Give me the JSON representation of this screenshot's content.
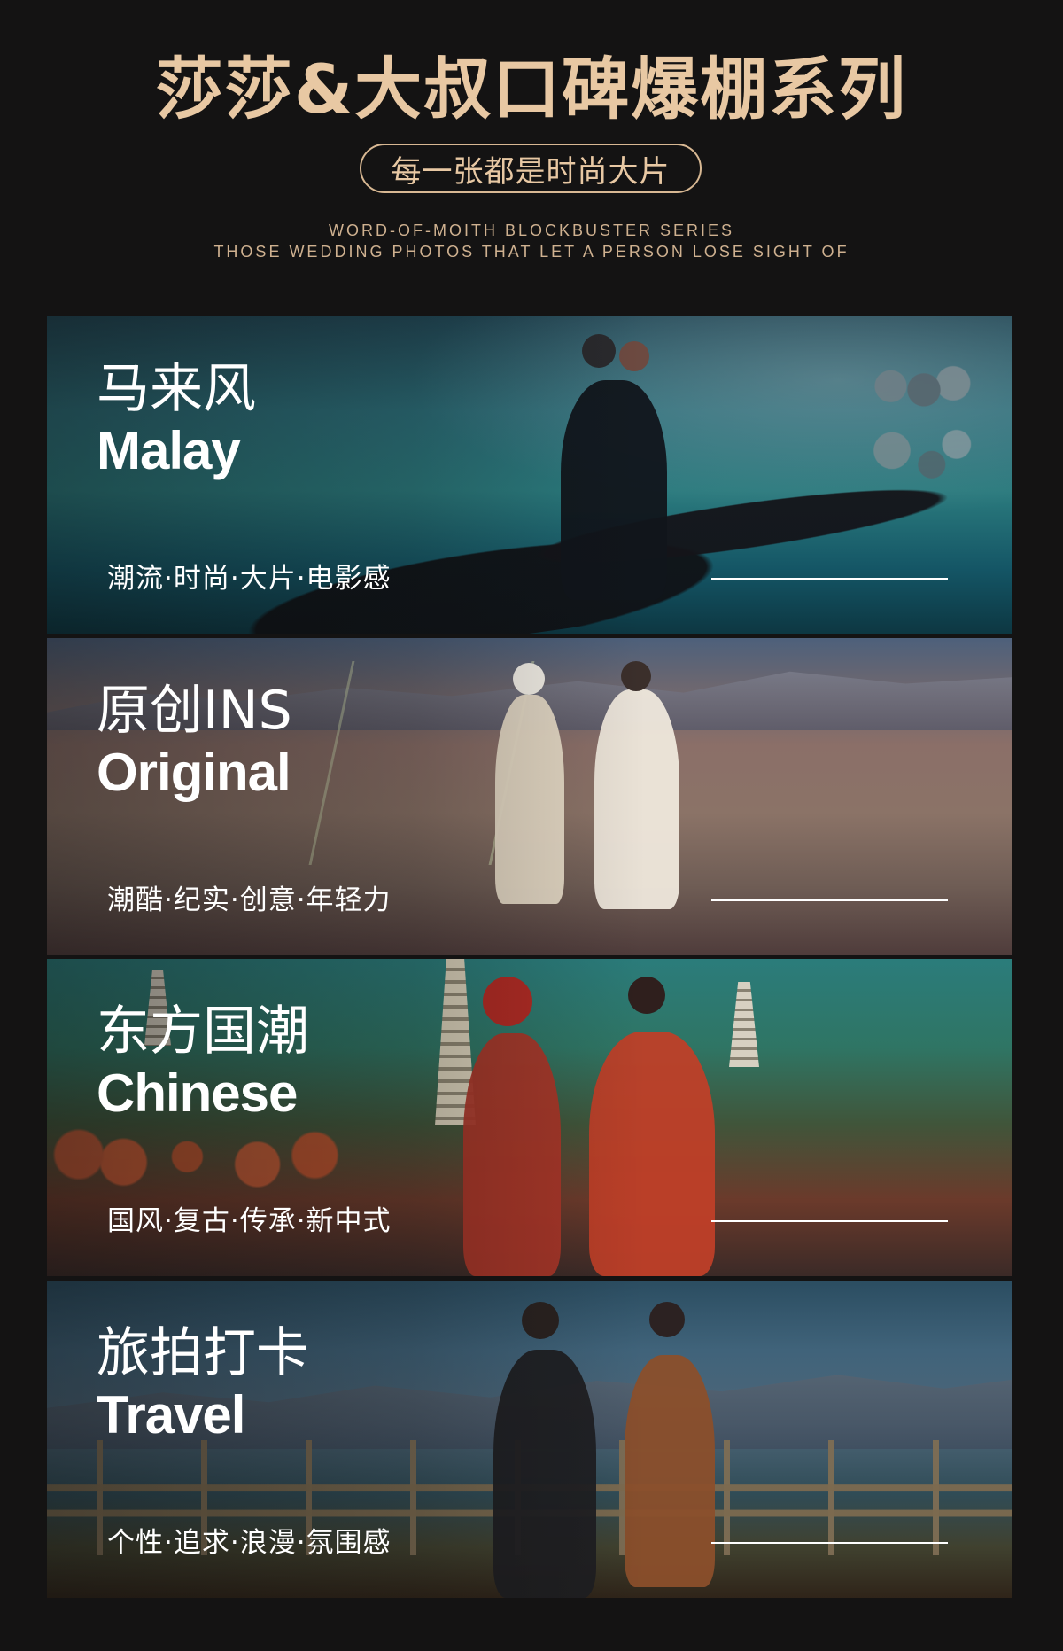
{
  "header": {
    "title": "莎莎&大叔口碑爆棚系列",
    "subtitle": "每一张都是时尚大片",
    "english_line_1": "WORD-OF-MOITH BLOCKBUSTER SERIES",
    "english_line_2": "THOSE WEDDING PHOTOS THAT LET A PERSON LOSE SIGHT OF"
  },
  "panels": [
    {
      "cn_title": "马来风",
      "en_title": "Malay",
      "tagline": "潮流·时尚·大片·电影感"
    },
    {
      "cn_title": "原创INS",
      "en_title": "Original",
      "tagline": "潮酷·纪实·创意·年轻力"
    },
    {
      "cn_title": "东方国潮",
      "en_title": "Chinese",
      "tagline": "国风·复古·传承·新中式"
    },
    {
      "cn_title": "旅拍打卡",
      "en_title": "Travel",
      "tagline": "个性·追求·浪漫·氛围感"
    }
  ],
  "colors": {
    "page_background": "#141313",
    "gold_accent": "#e8c8a3",
    "white": "#ffffff"
  }
}
